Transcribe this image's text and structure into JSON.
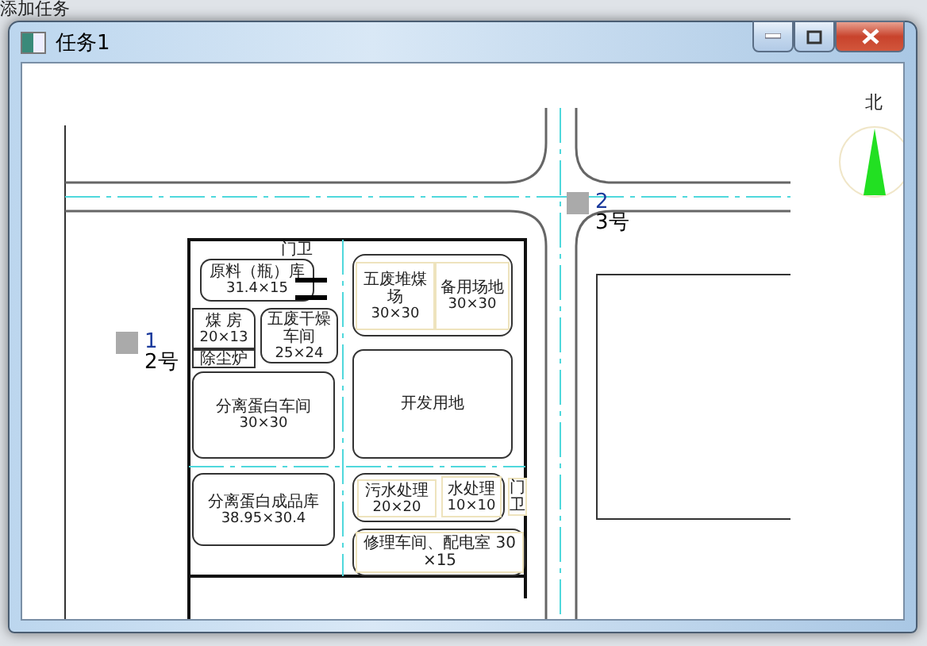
{
  "background": {
    "text": "添加任务"
  },
  "window": {
    "title": "任务1"
  },
  "plan": {
    "north_label": "北",
    "gate_top": "门卫",
    "gate_right": "门卫",
    "buildings": [
      {
        "name": "原料（瓶）库",
        "size": "31.4×15"
      },
      {
        "name": "煤 房",
        "size": "20×13"
      },
      {
        "name": "除尘炉"
      },
      {
        "name": "五废干燥车间",
        "size": "25×24"
      },
      {
        "name": "五废堆煤场",
        "size": "30×30"
      },
      {
        "name": "备用场地",
        "size": "30×30"
      },
      {
        "name": "分离蛋白车间",
        "size": "30×30"
      },
      {
        "name": "开发用地"
      },
      {
        "name": "分离蛋白成品库",
        "size": "38.95×30.4"
      },
      {
        "name": "污水处理",
        "size": "20×20"
      },
      {
        "name": "水处理",
        "size": "10×10"
      },
      {
        "name": "修理车间、配电室 30×15"
      }
    ],
    "markers": [
      {
        "number": "1",
        "label": "2号"
      },
      {
        "number": "2",
        "label": "3号"
      }
    ]
  }
}
